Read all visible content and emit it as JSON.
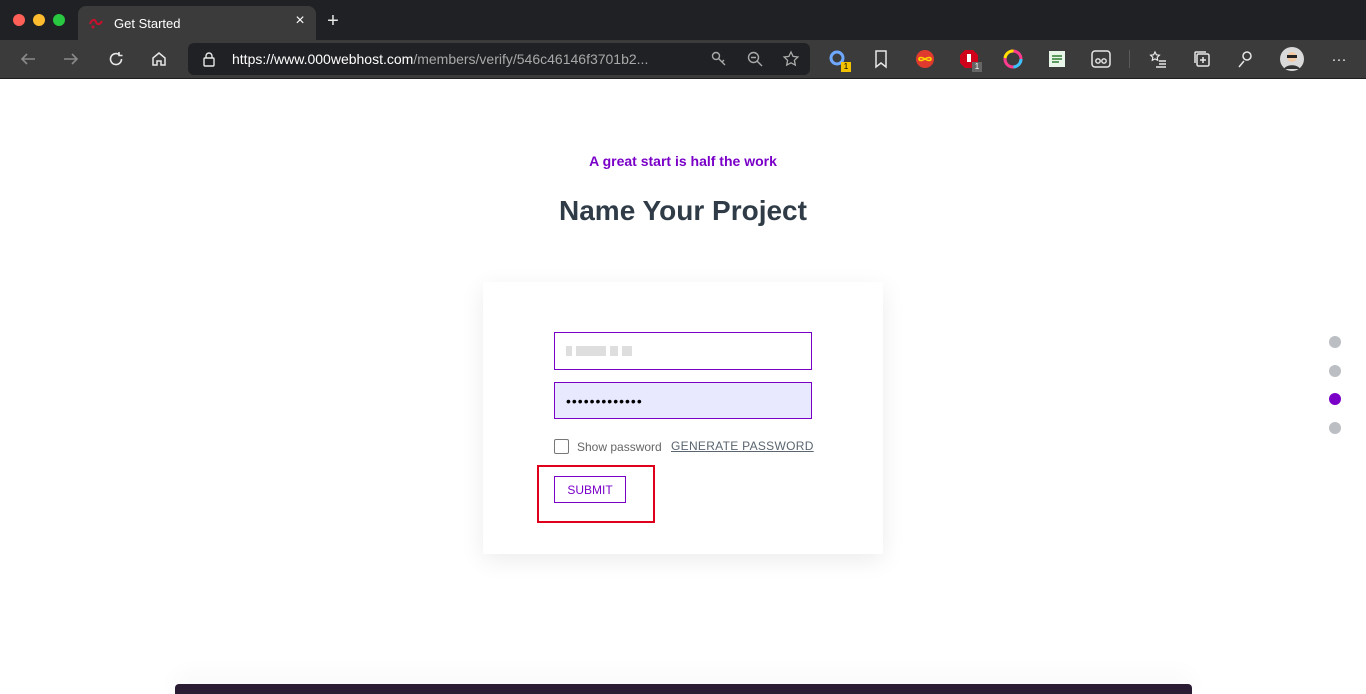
{
  "browser": {
    "tab_title": "Get Started",
    "tab_close_glyph": "×",
    "new_tab_glyph": "+",
    "url_host": "https://www.000webhost.com",
    "url_path": "/members/verify/546c46146f3701b2...",
    "extension_badge_1": "1",
    "extension_badge_2": "1",
    "more_glyph": "···"
  },
  "page": {
    "kicker": "A great start is half the work",
    "headline": "Name Your Project"
  },
  "form": {
    "name_value": "",
    "password_masked": "•••••••••••••",
    "show_password_label": "Show password",
    "generate_password_label": "GENERATE PASSWORD",
    "submit_label": "SUBMIT"
  },
  "steps": {
    "active_index": 2,
    "colors": {
      "inactive": "#bbbfc3",
      "active": "#7a00c8"
    }
  },
  "colors": {
    "accent": "#7a00c8",
    "heading": "#2f3c47",
    "highlight": "#e1001b"
  }
}
